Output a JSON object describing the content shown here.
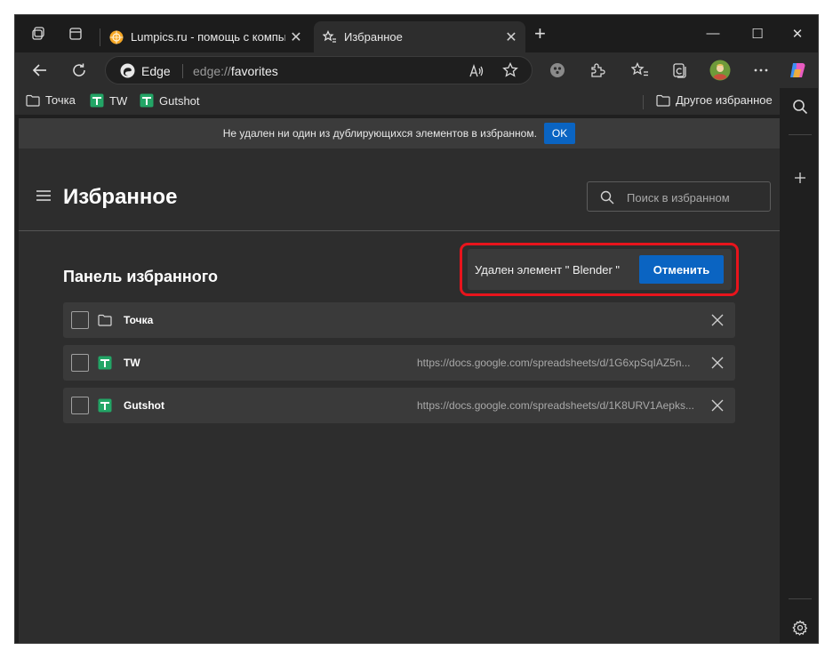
{
  "browser": {
    "tabs": [
      {
        "title": "Lumpics.ru - помощь с компьют",
        "close": "✕",
        "favicon": "orange-circle-favicon"
      },
      {
        "title": "Избранное",
        "close": "✕",
        "favicon": "star-list-icon"
      }
    ],
    "new_tab": "+",
    "window_controls": {
      "minimize": "—",
      "maximize": "☐",
      "close": "✕"
    },
    "address": {
      "brand": "Edge",
      "protocol": "edge://",
      "path": "favorites"
    }
  },
  "bookmarks_bar": {
    "items": [
      {
        "label": "Точка",
        "icon": "folder-icon"
      },
      {
        "label": "TW",
        "icon": "google-sheets-icon"
      },
      {
        "label": "Gutshot",
        "icon": "google-sheets-icon"
      }
    ],
    "other": "Другое избранное"
  },
  "notice": {
    "text": "Не удален ни один из дублирующихся элементов в избранном.",
    "ok": "OK"
  },
  "page": {
    "title": "Избранное",
    "search_placeholder": "Поиск в избранном",
    "section_title": "Панель избранного"
  },
  "toast": {
    "message": "Удален элемент \" Blender \"",
    "undo": "Отменить"
  },
  "favorites": [
    {
      "name": "Точка",
      "url": "",
      "type": "folder"
    },
    {
      "name": "TW",
      "url": "https://docs.google.com/spreadsheets/d/1G6xpSqIAZ5n...",
      "type": "sheet"
    },
    {
      "name": "Gutshot",
      "url": "https://docs.google.com/spreadsheets/d/1K8URV1Aepks...",
      "type": "sheet"
    }
  ],
  "colors": {
    "accent": "#0a64c2",
    "highlight": "#e8141c",
    "sheets_green": "#23a566",
    "background": "#2d2d2d"
  }
}
